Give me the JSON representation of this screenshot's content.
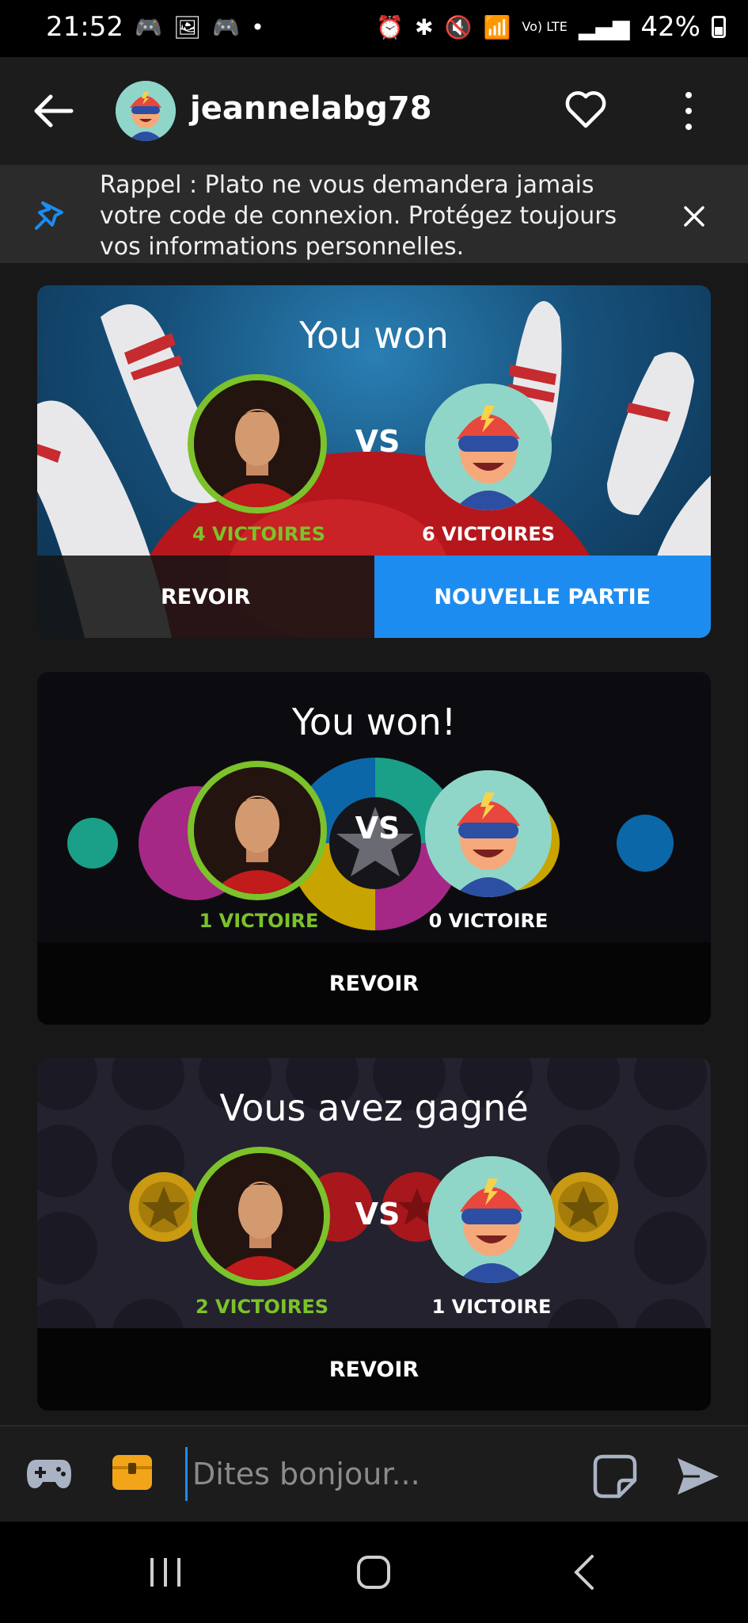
{
  "status_bar": {
    "time": "21:52",
    "battery": "42%",
    "network": "Vo) LTE"
  },
  "header": {
    "username": "jeannelabg78"
  },
  "banner": {
    "text": "Rappel : Plato ne vous demandera jamais votre code de connexion. Protégez toujours vos informations personnelles."
  },
  "cards": [
    {
      "title": "You won",
      "vs": "VS",
      "my_wins": "4 VICTOIRES",
      "opp_wins": "6 VICTOIRES",
      "replay": "REVOIR",
      "new_game": "NOUVELLE PARTIE",
      "theme": "bowling"
    },
    {
      "title": "You won!",
      "vs": "VS",
      "my_wins": "1 VICTOIRE",
      "opp_wins": "0 VICTOIRE",
      "replay": "REVOIR",
      "theme": "circles"
    },
    {
      "title": "Vous avez gagné",
      "vs": "VS",
      "my_wins": "2 VICTOIRES",
      "opp_wins": "1 VICTOIRE",
      "replay": "REVOIR",
      "theme": "connect-four"
    }
  ],
  "composer": {
    "placeholder": "Dites bonjour..."
  },
  "icons": {
    "back": "arrow-left-icon",
    "heart": "heart-icon",
    "menu": "more-vertical-icon",
    "pin": "pin-icon",
    "close": "close-icon",
    "gamepad": "gamepad-icon",
    "chest": "treasure-chest-icon",
    "sticker": "sticker-icon",
    "send": "send-icon"
  },
  "colors": {
    "accent_blue": "#1d8cf0",
    "win_green": "#7cc22a",
    "background": "#181818"
  }
}
